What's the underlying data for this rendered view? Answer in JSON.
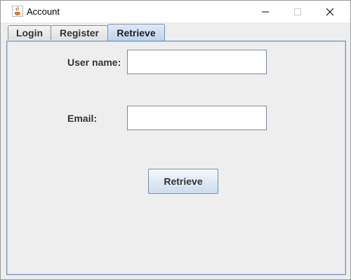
{
  "window": {
    "title": "Account",
    "icon": "java-cup-icon"
  },
  "tabs": [
    {
      "label": "Login",
      "selected": false
    },
    {
      "label": "Register",
      "selected": false
    },
    {
      "label": "Retrieve",
      "selected": true
    }
  ],
  "form": {
    "username_label": "User name:",
    "username_value": "",
    "email_label": "Email:",
    "email_value": "",
    "retrieve_label": "Retrieve"
  },
  "colors": {
    "selected_tab": "#c8dbef",
    "panel_border": "#7a96b6",
    "background": "#eeeeee"
  }
}
